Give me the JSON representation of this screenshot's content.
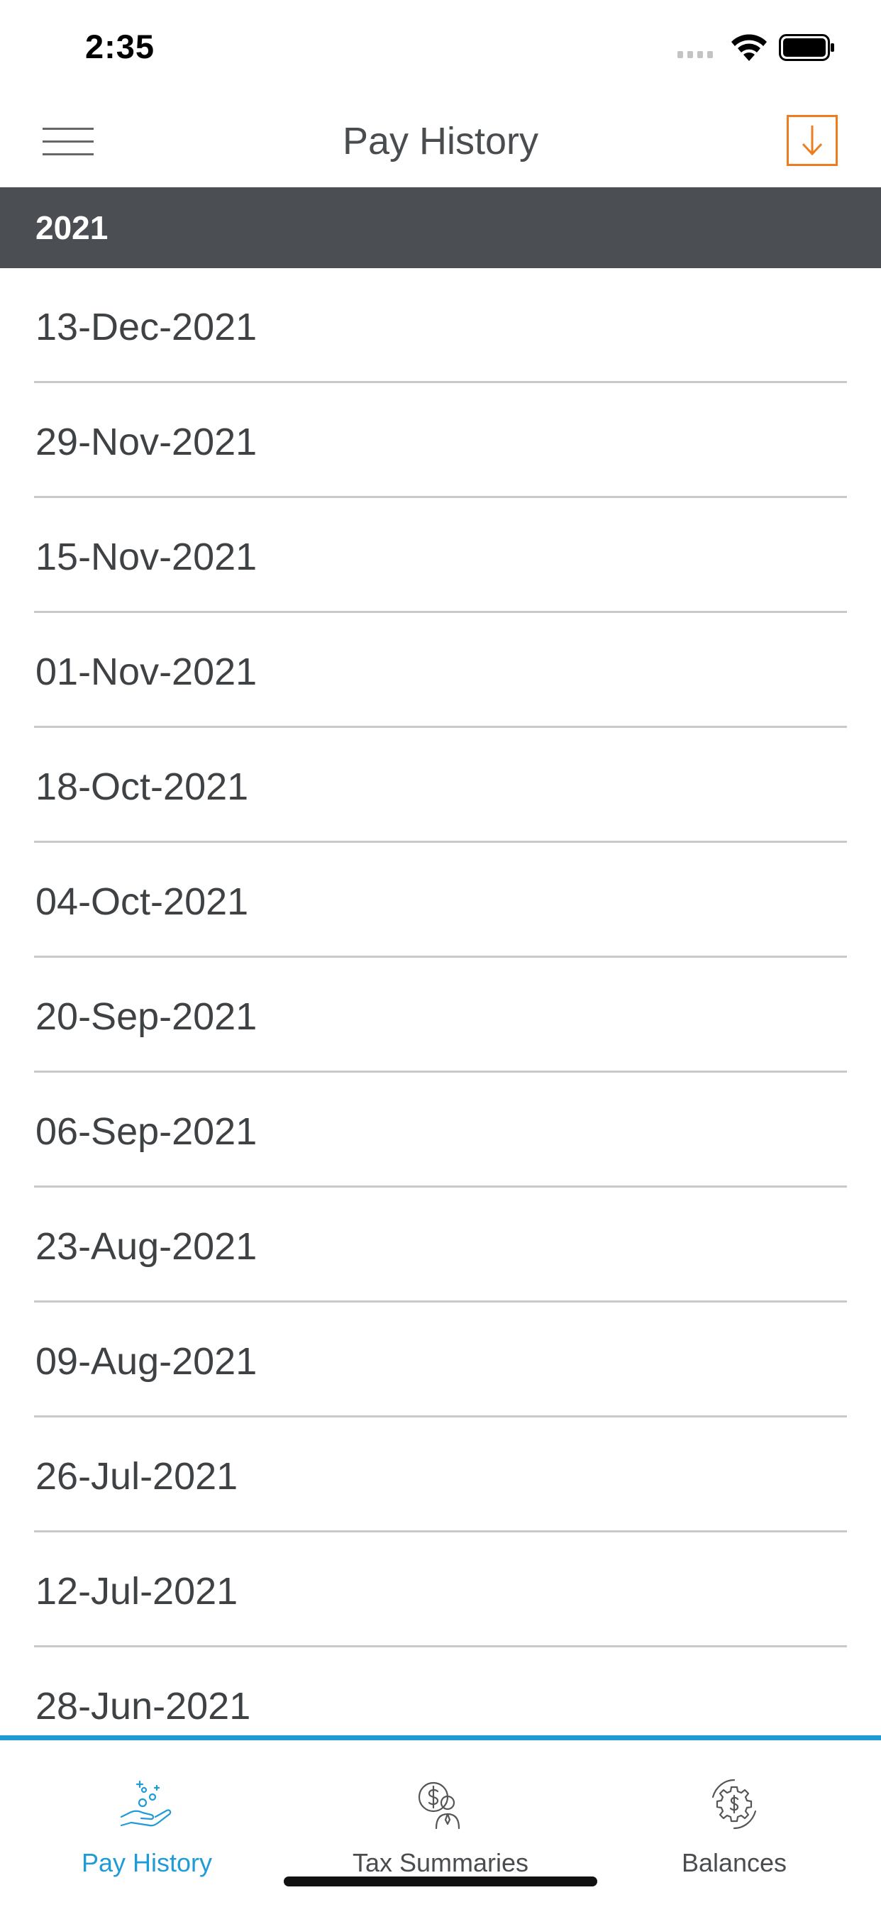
{
  "status_bar": {
    "time": "2:35"
  },
  "header": {
    "title": "Pay History"
  },
  "section": {
    "year": "2021"
  },
  "pay_dates": [
    "13-Dec-2021",
    "29-Nov-2021",
    "15-Nov-2021",
    "01-Nov-2021",
    "18-Oct-2021",
    "04-Oct-2021",
    "20-Sep-2021",
    "06-Sep-2021",
    "23-Aug-2021",
    "09-Aug-2021",
    "26-Jul-2021",
    "12-Jul-2021",
    "28-Jun-2021"
  ],
  "tabs": [
    {
      "label": "Pay History",
      "icon": "pay-history-icon",
      "active": true
    },
    {
      "label": "Tax Summaries",
      "icon": "tax-summaries-icon",
      "active": false
    },
    {
      "label": "Balances",
      "icon": "balances-icon",
      "active": false
    }
  ],
  "colors": {
    "accent": "#1f9bd6",
    "download": "#ee7d1f",
    "section_bg": "#4b4f53"
  }
}
